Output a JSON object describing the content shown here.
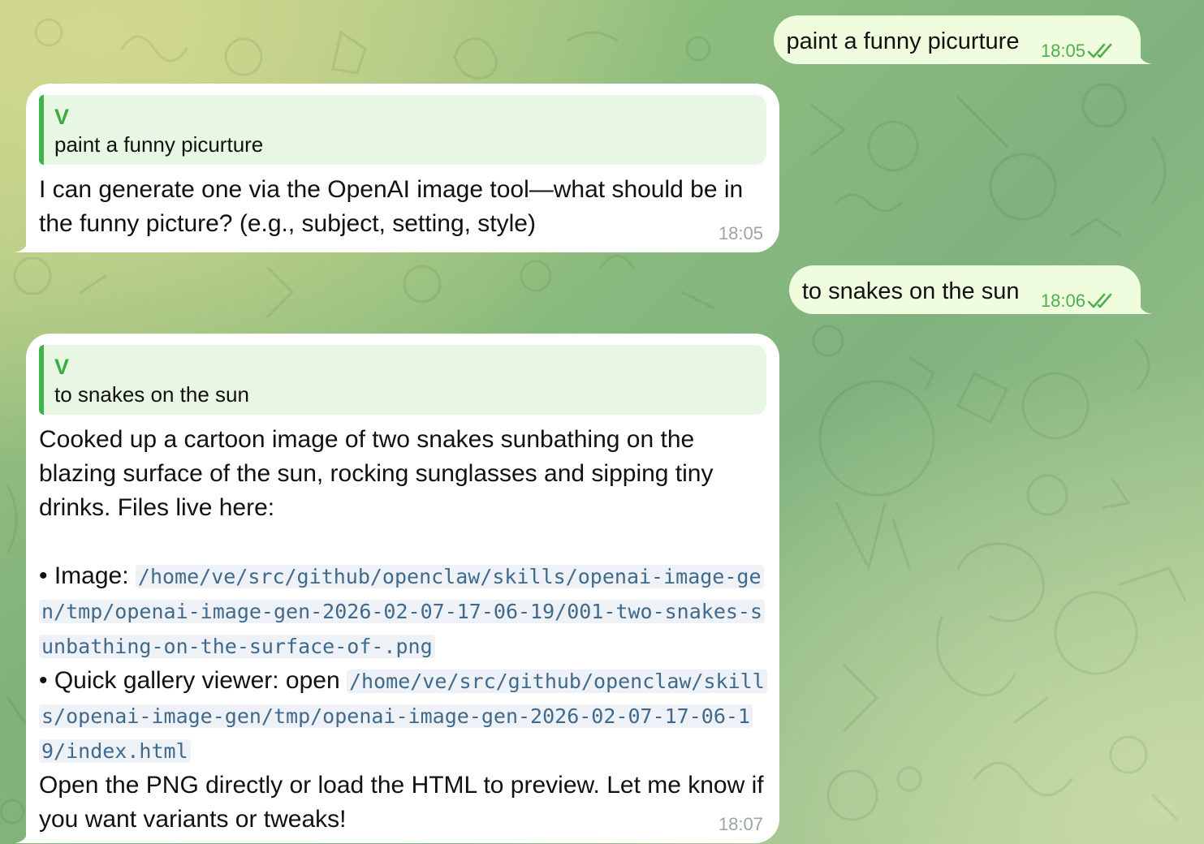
{
  "colors": {
    "outgoing_bubble": "#effdde",
    "incoming_bubble": "#ffffff",
    "accent_green": "#3fb44a",
    "code_text": "#3f6a8d",
    "timestamp_in": "#9ba5a8",
    "timestamp_out": "#4fae4e"
  },
  "messages": [
    {
      "direction": "outgoing",
      "text": "paint a funny picurture",
      "time": "18:05",
      "status_icon": "double-check-icon"
    },
    {
      "direction": "incoming",
      "reply_to": {
        "author": "V",
        "text": "paint a funny picurture"
      },
      "text": "I can generate one via the OpenAI image tool—what should be in the funny picture? (e.g., subject, setting, style)",
      "time": "18:05"
    },
    {
      "direction": "outgoing",
      "text": "to snakes on the sun",
      "time": "18:06",
      "status_icon": "double-check-icon"
    },
    {
      "direction": "incoming",
      "reply_to": {
        "author": "V",
        "text": "to snakes on the sun"
      },
      "intro": "Cooked up a cartoon image of two snakes sunbathing on the blazing surface of the sun, rocking sunglasses and sipping tiny drinks. Files live here:",
      "bullet1_label": "• Image: ",
      "bullet1_path": "/home/ve/src/github/openclaw/skills/openai-image-gen/tmp/openai-image-gen-2026-02-07-17-06-19/001-two-snakes-sunbathing-on-the-surface-of-.png",
      "bullet2_label": "• Quick gallery viewer: open ",
      "bullet2_path": "/home/ve/src/github/openclaw/skills/openai-image-gen/tmp/openai-image-gen-2026-02-07-17-06-19/index.html",
      "outro": "Open the PNG directly or load the HTML to preview. Let me know if you want variants or tweaks!",
      "time": "18:07"
    }
  ]
}
